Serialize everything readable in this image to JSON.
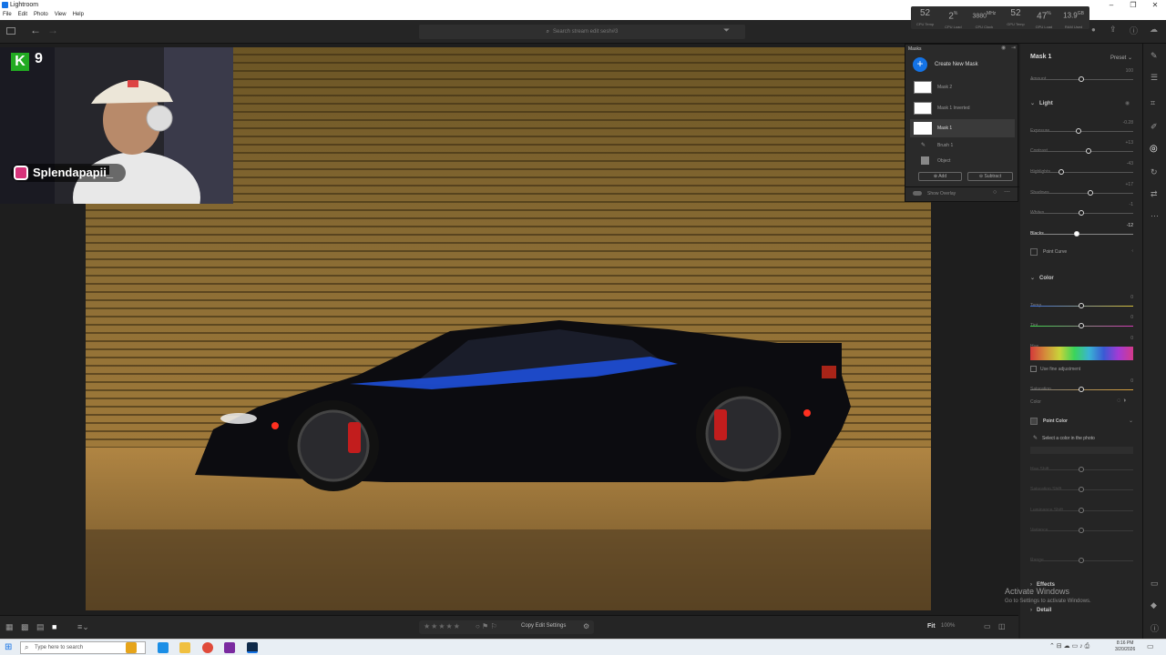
{
  "window": {
    "title": "Lightroom",
    "menus": [
      "File",
      "Edit",
      "Photo",
      "View",
      "Help"
    ]
  },
  "perf": [
    {
      "value": "52",
      "label": "CPU Temp"
    },
    {
      "value": "2",
      "unit": "%",
      "label": "CPU Load"
    },
    {
      "value": "3880",
      "unit": "MHz",
      "label": "CPU Clock"
    },
    {
      "value": "52",
      "label": "GPU Temp"
    },
    {
      "value": "47",
      "unit": "%",
      "label": "GPU Load"
    },
    {
      "value": "13.9",
      "unit": "GB",
      "label": "RAM Used"
    }
  ],
  "search": {
    "placeholder": "Search stream edit sesh#3"
  },
  "webcam": {
    "channel_badge": "K",
    "channel_num": "9",
    "instagram": "Splendapapii_"
  },
  "masks": {
    "title": "Masks",
    "create": "Create New Mask",
    "items": [
      "Mask 2",
      "Mask 1 Inverted",
      "Mask 1"
    ],
    "components": [
      "Brush 1",
      "Object"
    ],
    "add": "Add",
    "subtract": "Subtract",
    "overlay": "Show Overlay"
  },
  "panel": {
    "mask_name": "Mask 1",
    "preset": "Preset",
    "amount": {
      "label": "Amount",
      "value": "100",
      "pos": 0.5
    },
    "light": {
      "title": "Light",
      "sliders": [
        {
          "label": "Exposure",
          "value": "-0.28",
          "pos": 0.47
        },
        {
          "label": "Contrast",
          "value": "+13",
          "pos": 0.57
        },
        {
          "label": "Highlights",
          "value": "-43",
          "pos": 0.3
        },
        {
          "label": "Shadows",
          "value": "+17",
          "pos": 0.58
        },
        {
          "label": "Whites",
          "value": "-1",
          "pos": 0.5
        },
        {
          "label": "Blacks",
          "value": "-12",
          "pos": 0.45
        }
      ]
    },
    "point_curve": "Point Curve",
    "color": {
      "title": "Color",
      "sliders": [
        {
          "label": "Temp",
          "value": "0",
          "pos": 0.5
        },
        {
          "label": "Tint",
          "value": "0",
          "pos": 0.5
        },
        {
          "label": "Hue",
          "value": "0",
          "pos": 0.5
        }
      ],
      "fine": "Use fine adjustment",
      "saturation": {
        "label": "Saturation",
        "value": "0",
        "pos": 0.5
      },
      "color_label": "Color"
    },
    "point_color": {
      "title": "Point Color",
      "select": "Select a color in the photo",
      "sliders": [
        "Hue Shift",
        "Saturation Shift",
        "Luminance Shift",
        "Variance",
        "Range"
      ]
    },
    "effects": "Effects",
    "detail": "Detail"
  },
  "bottom": {
    "copy": "Copy Edit Settings",
    "fit": "Fit",
    "zoom": "100%"
  },
  "taskbar": {
    "search": "Type here to search",
    "time": "8:16 PM",
    "date": "3/20/2026"
  },
  "watermark": {
    "title": "Activate Windows",
    "sub": "Go to Settings to activate Windows."
  }
}
